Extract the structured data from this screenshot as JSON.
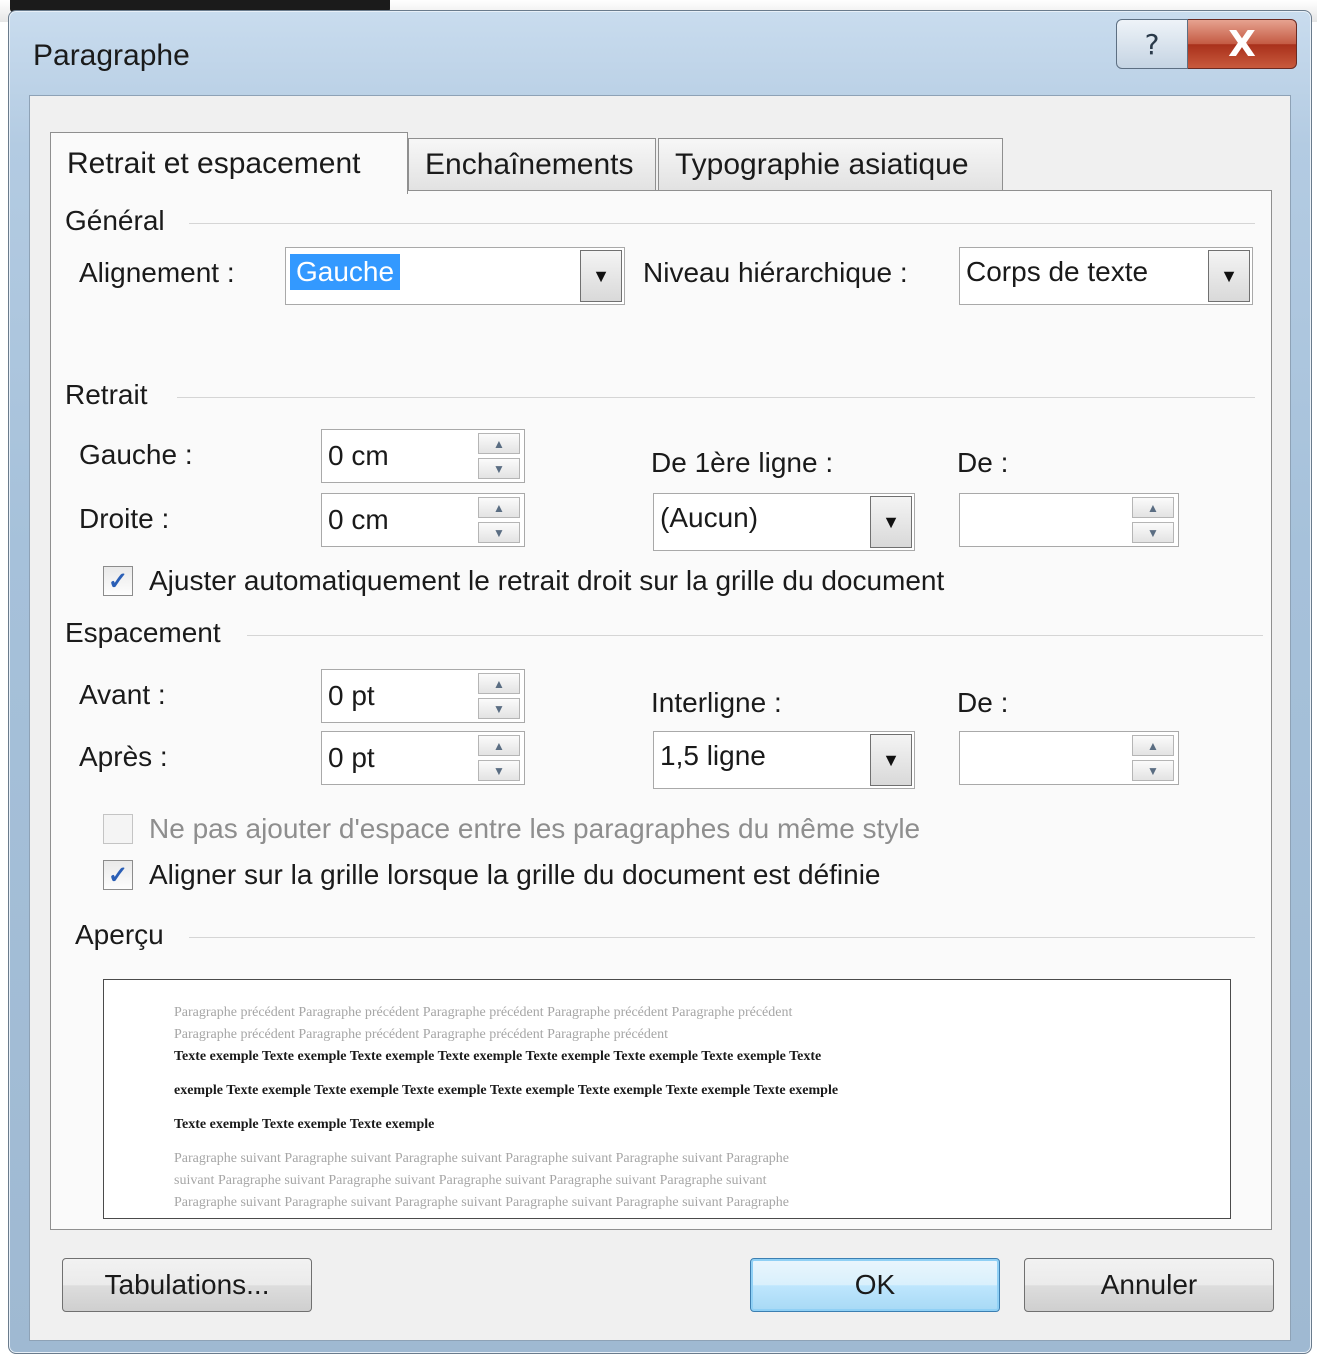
{
  "window": {
    "title": "Paragraphe",
    "help_label": "?",
    "close_label": "X"
  },
  "tabs": [
    {
      "label": "Retrait et espacement",
      "active": true
    },
    {
      "label": "Enchaînements",
      "active": false
    },
    {
      "label": "Typographie asiatique",
      "active": false
    }
  ],
  "general": {
    "section": "Général",
    "alignment_label": "Alignement :",
    "alignment_value": "Gauche",
    "outline_label": "Niveau hiérarchique :",
    "outline_value": "Corps de texte"
  },
  "indent": {
    "section": "Retrait",
    "left_label": "Gauche :",
    "left_value": "0 cm",
    "right_label": "Droite :",
    "right_value": "0 cm",
    "special_label": "De 1ère ligne :",
    "special_value": "(Aucun)",
    "by_label": "De :",
    "by_value": "",
    "mirror_checkbox": "Ajuster automatiquement le retrait droit sur la grille du document",
    "mirror_checked": true
  },
  "spacing": {
    "section": "Espacement",
    "before_label": "Avant :",
    "before_value": "0 pt",
    "after_label": "Après :",
    "after_value": "0 pt",
    "line_label": "Interligne :",
    "line_value": "1,5 ligne",
    "at_label": "De :",
    "at_value": "",
    "no_space_checkbox": "Ne pas ajouter d'espace entre les paragraphes du même style",
    "no_space_checked": false,
    "snap_checkbox": "Aligner sur la grille lorsque la grille du document est définie",
    "snap_checked": true
  },
  "preview": {
    "section": "Aperçu",
    "prev_line1": "Paragraphe précédent Paragraphe précédent Paragraphe précédent Paragraphe précédent Paragraphe précédent",
    "prev_line2": "Paragraphe précédent Paragraphe précédent Paragraphe précédent Paragraphe précédent",
    "sample_line1": "Texte exemple Texte exemple Texte exemple Texte exemple Texte exemple Texte exemple Texte exemple Texte",
    "sample_line2": "exemple Texte exemple Texte exemple Texte exemple Texte exemple Texte exemple Texte exemple Texte exemple",
    "sample_line3": "Texte exemple Texte exemple Texte exemple",
    "next_line1": "Paragraphe suivant Paragraphe suivant Paragraphe suivant Paragraphe suivant Paragraphe suivant Paragraphe",
    "next_line2": "suivant Paragraphe suivant Paragraphe suivant Paragraphe suivant Paragraphe suivant Paragraphe suivant",
    "next_line3": "Paragraphe suivant Paragraphe suivant Paragraphe suivant Paragraphe suivant Paragraphe suivant Paragraphe"
  },
  "buttons": {
    "tabs": "Tabulations...",
    "ok": "OK",
    "cancel": "Annuler"
  }
}
